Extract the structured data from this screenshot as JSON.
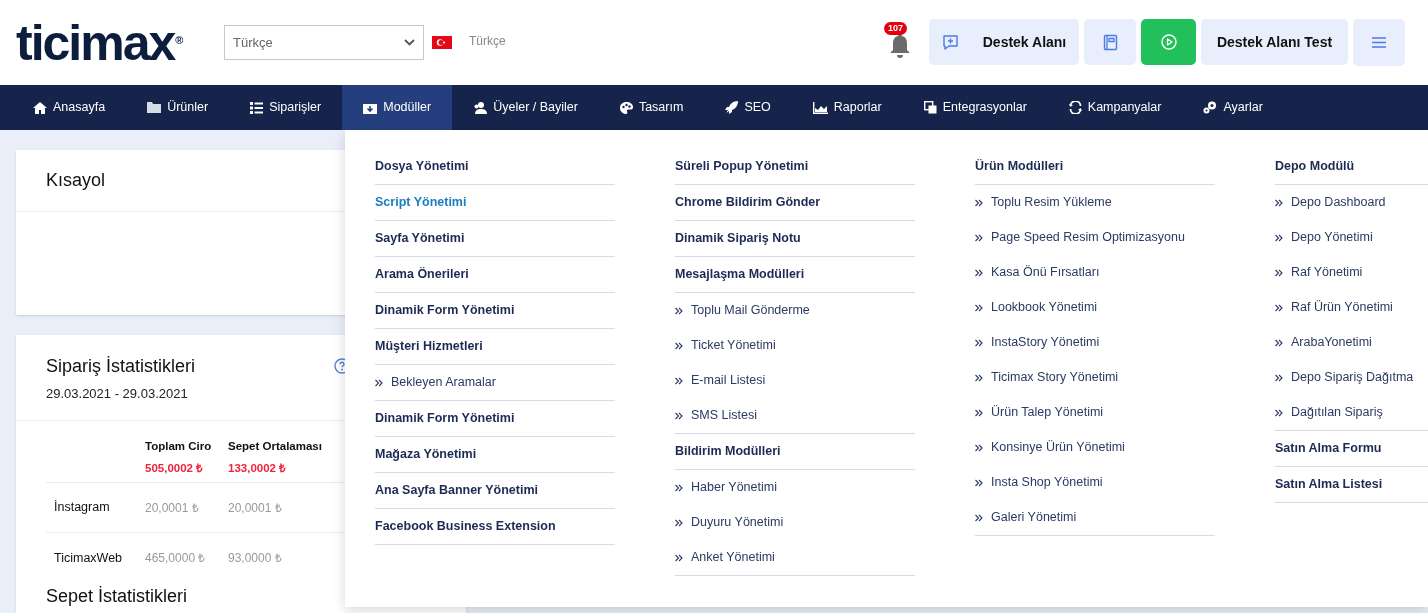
{
  "header": {
    "logo": {
      "text": "ticimax",
      "mark": "®"
    },
    "language_select": {
      "value": "Türkçe"
    },
    "language_label": "Türkçe",
    "notifications": {
      "count": "107"
    },
    "buttons": [
      {
        "kind": "support",
        "label": "Destek Alanı"
      },
      {
        "kind": "book"
      },
      {
        "kind": "play"
      },
      {
        "kind": "text",
        "label": "Destek Alanı Test"
      },
      {
        "kind": "menu"
      }
    ]
  },
  "nav": [
    {
      "label": "Anasayfa",
      "selected": false
    },
    {
      "label": "Ürünler",
      "selected": false
    },
    {
      "label": "Siparişler",
      "selected": false
    },
    {
      "label": "Modüller",
      "selected": true
    },
    {
      "label": "Üyeler / Bayiler",
      "selected": false
    },
    {
      "label": "Tasarım",
      "selected": false
    },
    {
      "label": "SEO",
      "selected": false
    },
    {
      "label": "Raporlar",
      "selected": false
    },
    {
      "label": "Entegrasyonlar",
      "selected": false
    },
    {
      "label": "Kampanyalar",
      "selected": false
    },
    {
      "label": "Ayarlar",
      "selected": false
    }
  ],
  "mega_menu": {
    "columns": [
      [
        {
          "kind": "link",
          "label": "Dosya Yönetimi",
          "selected": false
        },
        {
          "kind": "link",
          "label": "Script Yönetimi",
          "selected": true
        },
        {
          "kind": "link",
          "label": "Sayfa Yönetimi",
          "selected": false
        },
        {
          "kind": "link",
          "label": "Arama Önerileri",
          "selected": false
        },
        {
          "kind": "link",
          "label": "Dinamik Form Yönetimi",
          "selected": false
        },
        {
          "kind": "heading",
          "label": "Müşteri Hizmetleri",
          "selected": false
        },
        {
          "kind": "subitem",
          "label": "Bekleyen Aramalar",
          "selected": false
        },
        {
          "kind": "link",
          "label": "Dinamik Form Yönetimi",
          "selected": false
        },
        {
          "kind": "link",
          "label": "Mağaza Yönetimi",
          "selected": false
        },
        {
          "kind": "link",
          "label": "Ana Sayfa Banner Yönetimi",
          "selected": false
        },
        {
          "kind": "link",
          "label": "Facebook Business Extension",
          "selected": false
        }
      ],
      [
        {
          "kind": "link",
          "label": "Süreli Popup Yönetimi",
          "selected": false
        },
        {
          "kind": "link",
          "label": "Chrome Bildirim Gönder",
          "selected": false
        },
        {
          "kind": "link",
          "label": "Dinamik Sipariş Notu",
          "selected": false
        },
        {
          "kind": "heading",
          "label": "Mesajlaşma Modülleri",
          "selected": false
        },
        {
          "kind": "subitem",
          "label": "Toplu Mail Gönderme",
          "selected": false
        },
        {
          "kind": "subitem",
          "label": "Ticket Yönetimi",
          "selected": false
        },
        {
          "kind": "subitem",
          "label": "E-mail Listesi",
          "selected": false
        },
        {
          "kind": "subitem",
          "label": "SMS Listesi",
          "selected": false
        },
        {
          "kind": "heading",
          "label": "Bildirim Modülleri",
          "selected": false
        },
        {
          "kind": "subitem",
          "label": "Haber Yönetimi",
          "selected": false
        },
        {
          "kind": "subitem",
          "label": "Duyuru Yönetimi",
          "selected": false
        },
        {
          "kind": "subitem",
          "label": "Anket Yönetimi",
          "selected": false
        }
      ],
      [
        {
          "kind": "heading",
          "label": "Ürün Modülleri",
          "selected": false
        },
        {
          "kind": "subitem",
          "label": "Toplu Resim Yükleme",
          "selected": false
        },
        {
          "kind": "subitem",
          "label": "Page Speed Resim Optimizasyonu",
          "selected": false
        },
        {
          "kind": "subitem",
          "label": "Kasa Önü Fırsatları",
          "selected": false
        },
        {
          "kind": "subitem",
          "label": "Lookbook Yönetimi",
          "selected": false
        },
        {
          "kind": "subitem",
          "label": "InstaStory Yönetimi",
          "selected": false
        },
        {
          "kind": "subitem",
          "label": "Ticimax Story Yönetimi",
          "selected": false
        },
        {
          "kind": "subitem",
          "label": "Ürün Talep Yönetimi",
          "selected": false
        },
        {
          "kind": "subitem",
          "label": "Konsinye Ürün Yönetimi",
          "selected": false
        },
        {
          "kind": "subitem",
          "label": "Insta Shop Yönetimi",
          "selected": false
        },
        {
          "kind": "subitem",
          "label": "Galeri Yönetimi",
          "selected": false
        }
      ],
      [
        {
          "kind": "heading",
          "label": "Depo Modülü",
          "selected": false
        },
        {
          "kind": "subitem",
          "label": "Depo Dashboard",
          "selected": false
        },
        {
          "kind": "subitem",
          "label": "Depo Yönetimi",
          "selected": false
        },
        {
          "kind": "subitem",
          "label": "Raf Yönetimi",
          "selected": false
        },
        {
          "kind": "subitem",
          "label": "Raf Ürün Yönetimi",
          "selected": false
        },
        {
          "kind": "subitem",
          "label": "ArabaYonetimi",
          "selected": false
        },
        {
          "kind": "subitem",
          "label": "Depo Sipariş Dağıtma",
          "selected": false
        },
        {
          "kind": "subitem",
          "label": "Dağıtılan Sipariş",
          "selected": false
        },
        {
          "kind": "link",
          "label": "Satın Alma Formu",
          "selected": false
        },
        {
          "kind": "link",
          "label": "Satın Alma Listesi",
          "selected": false
        }
      ]
    ]
  },
  "shortcut_card": {
    "title": "Kısayol"
  },
  "order_stats": {
    "title": "Sipariş İstatistikleri",
    "date_range": "29.03.2021 - 29.03.2021",
    "columns": [
      {
        "label": "Toplam Ciro",
        "total": "505,0002 ₺"
      },
      {
        "label": "Sepet Ortalaması",
        "total": "133,0002 ₺"
      }
    ],
    "rows": [
      {
        "name": "İnstagram",
        "values": [
          "20,0001 ₺",
          "20,0001 ₺"
        ]
      },
      {
        "name": "TicimaxWeb",
        "values": [
          "465,0000 ₺",
          "93,0000 ₺"
        ]
      }
    ]
  },
  "cart_stats": {
    "title": "Sepet İstatistikleri"
  }
}
